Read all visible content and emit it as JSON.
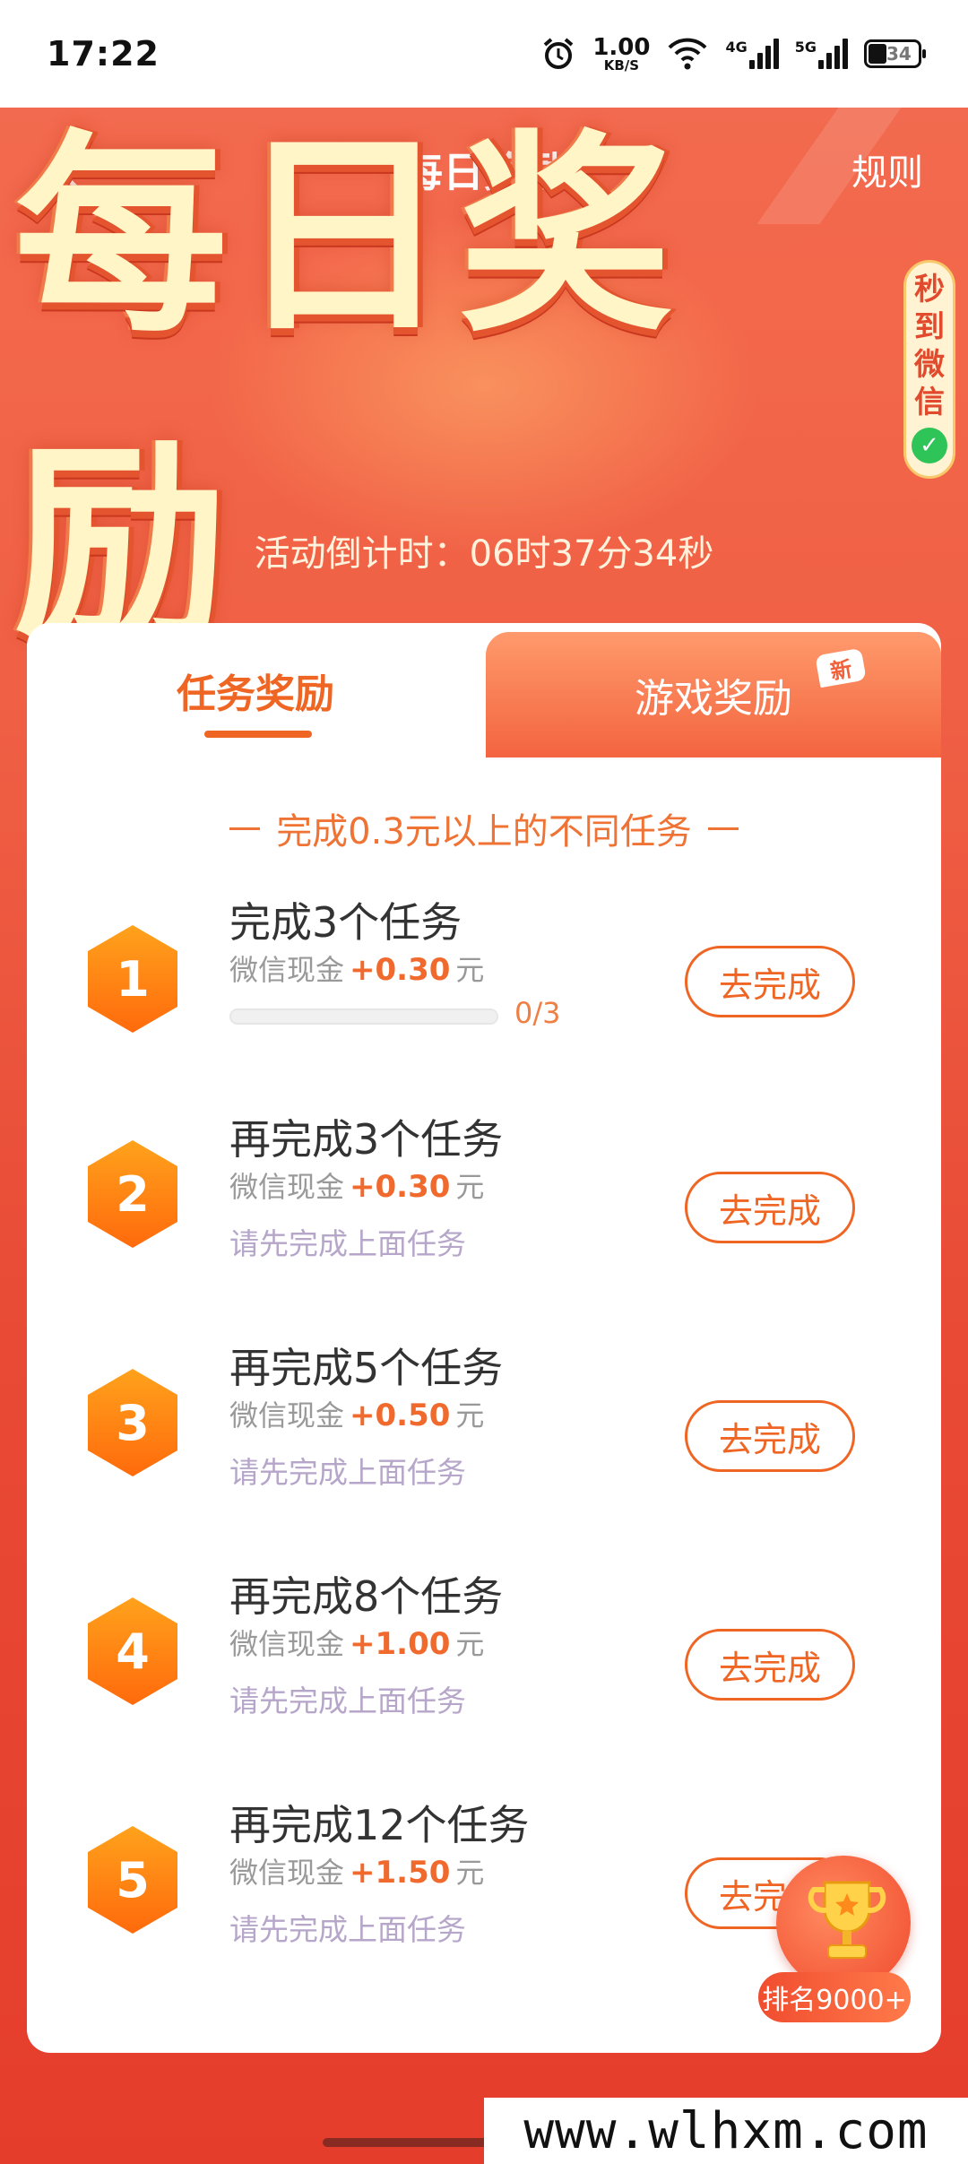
{
  "status_bar": {
    "time": "17:22",
    "net_speed_value": "1.00",
    "net_speed_unit": "KB/S",
    "signal1": "4G",
    "signal2": "5G",
    "battery": "34"
  },
  "header": {
    "title": "每日奖励",
    "rules_label": "规则",
    "banner_title": "每日奖励",
    "seal_chars": [
      "秒",
      "到",
      "微",
      "信"
    ],
    "countdown": "活动倒计时：06时37分34秒"
  },
  "tabs": [
    {
      "label": "任务奖励",
      "active": true
    },
    {
      "label": "游戏奖励",
      "active": false,
      "badge": "新"
    }
  ],
  "subtitle": "完成0.3元以上的不同任务",
  "tasks": [
    {
      "num": "1",
      "title": "完成3个任务",
      "reward_prefix": "微信现金",
      "reward": "+0.30",
      "unit": "元",
      "progress_text": "0/3",
      "progress": 0,
      "button": "去完成"
    },
    {
      "num": "2",
      "title": "再完成3个任务",
      "reward_prefix": "微信现金",
      "reward": "+0.30",
      "unit": "元",
      "hint": "请先完成上面任务",
      "button": "去完成"
    },
    {
      "num": "3",
      "title": "再完成5个任务",
      "reward_prefix": "微信现金",
      "reward": "+0.50",
      "unit": "元",
      "hint": "请先完成上面任务",
      "button": "去完成"
    },
    {
      "num": "4",
      "title": "再完成8个任务",
      "reward_prefix": "微信现金",
      "reward": "+1.00",
      "unit": "元",
      "hint": "请先完成上面任务",
      "button": "去完成"
    },
    {
      "num": "5",
      "title": "再完成12个任务",
      "reward_prefix": "微信现金",
      "reward": "+1.50",
      "unit": "元",
      "hint": "请先完成上面任务",
      "button": "去完成"
    }
  ],
  "ranking": {
    "label": "排名9000+"
  },
  "watermark": "www.wlhxm.com",
  "colors": {
    "accent": "#ef6524",
    "banner_red": "#f26a4f",
    "hint": "#b6a6c9"
  }
}
